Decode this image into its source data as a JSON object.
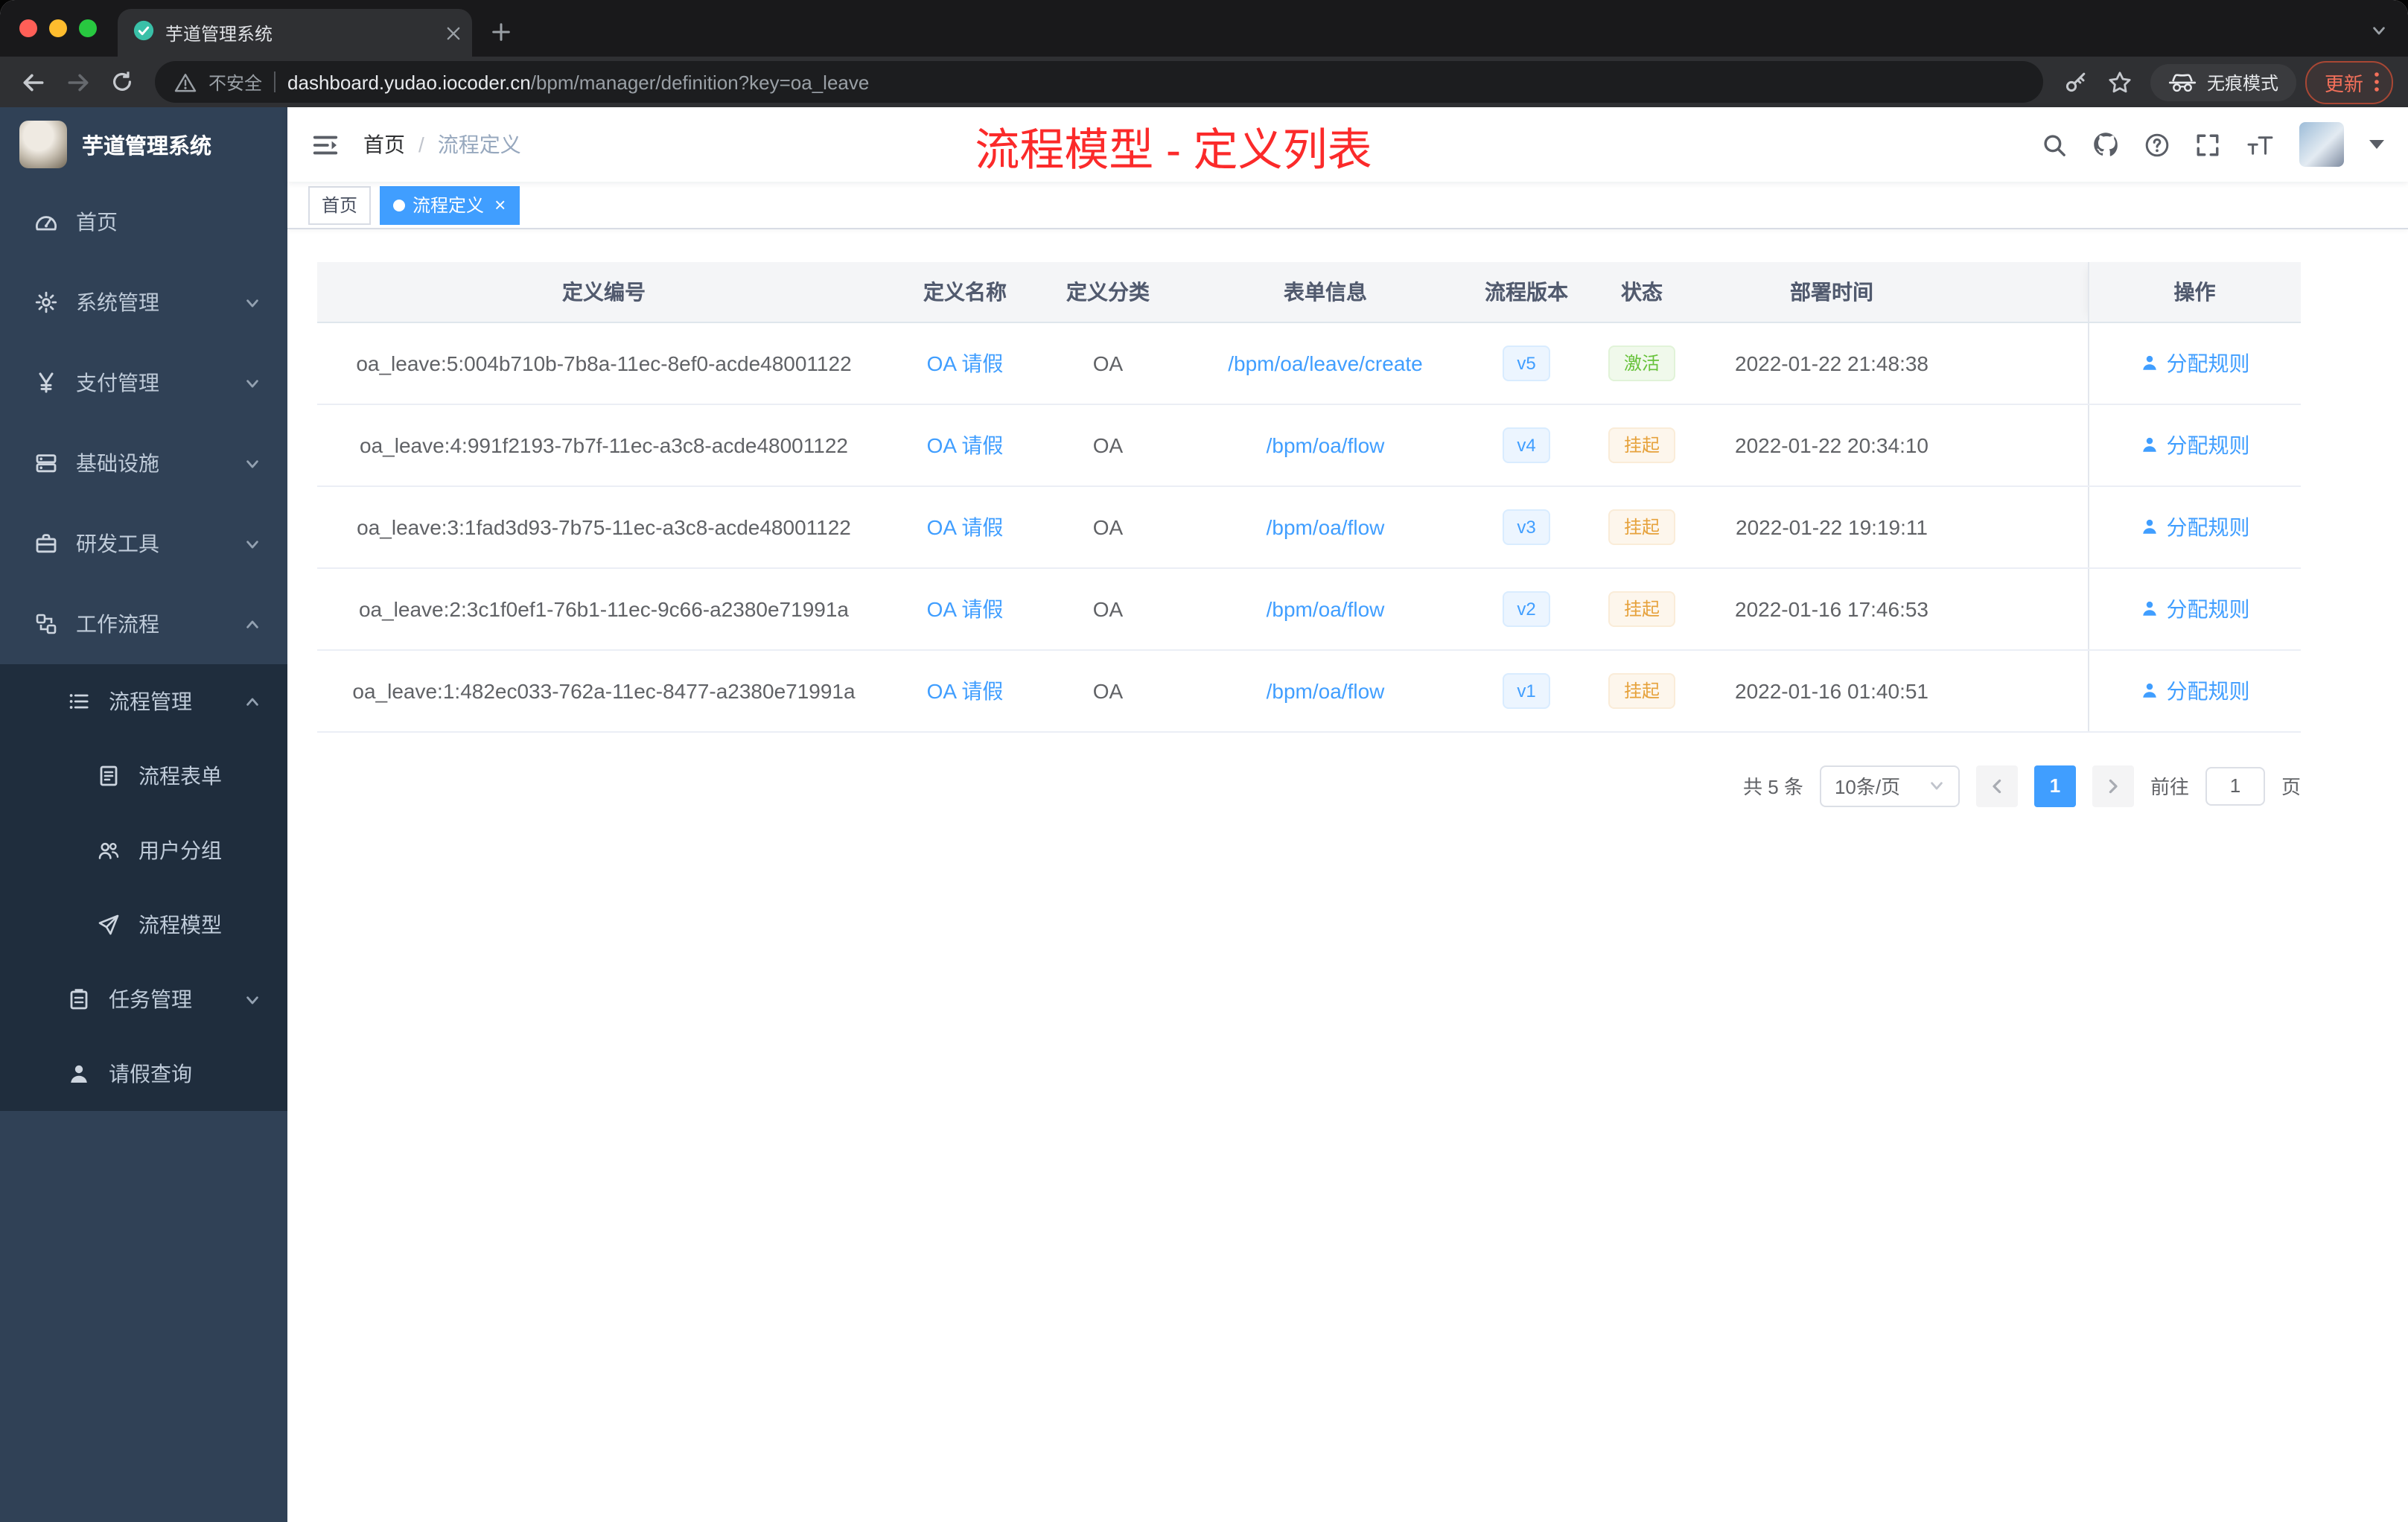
{
  "colors": {
    "accent": "#409eff",
    "annotation_red": "#fb2a2a",
    "status_active_green": "#67c23a",
    "status_suspended_orange": "#e6a23c",
    "sidebar_bg": "#304156",
    "sidebar_submenu_bg": "#1f2d3d"
  },
  "browser": {
    "tab": {
      "title": "芋道管理系统"
    },
    "address": {
      "security_label": "不安全",
      "host": "dashboard.yudao.iocoder.cn",
      "path": "/bpm/manager/definition?key=oa_leave",
      "incognito_label": "无痕模式",
      "update_label": "更新"
    }
  },
  "sidebar": {
    "logo_title": "芋道管理系统",
    "items": [
      {
        "key": "home",
        "label": "首页",
        "icon": "dashboard-icon",
        "level": 1,
        "arrow": null,
        "sub": false
      },
      {
        "key": "system-management",
        "label": "系统管理",
        "icon": "gear-icon",
        "level": 1,
        "arrow": "down",
        "sub": false
      },
      {
        "key": "payment-management",
        "label": "支付管理",
        "icon": "yen-icon",
        "level": 1,
        "arrow": "down",
        "sub": false
      },
      {
        "key": "infrastructure",
        "label": "基础设施",
        "icon": "server-icon",
        "level": 1,
        "arrow": "down",
        "sub": false
      },
      {
        "key": "dev-tools",
        "label": "研发工具",
        "icon": "toolbox-icon",
        "level": 1,
        "arrow": "down",
        "sub": false
      },
      {
        "key": "workflow",
        "label": "工作流程",
        "icon": "flow-icon",
        "level": 1,
        "arrow": "up",
        "sub": false
      },
      {
        "key": "process-management",
        "label": "流程管理",
        "icon": "list-icon",
        "level": 2,
        "arrow": "up",
        "sub": true
      },
      {
        "key": "process-form",
        "label": "流程表单",
        "icon": "form-icon",
        "level": 3,
        "arrow": null,
        "sub": true
      },
      {
        "key": "user-group",
        "label": "用户分组",
        "icon": "user-group-icon",
        "level": 3,
        "arrow": null,
        "sub": true
      },
      {
        "key": "process-model",
        "label": "流程模型",
        "icon": "paper-plane-icon",
        "level": 3,
        "arrow": null,
        "sub": true
      },
      {
        "key": "task-management",
        "label": "任务管理",
        "icon": "task-icon",
        "level": 2,
        "arrow": "down",
        "sub": true
      },
      {
        "key": "leave-query",
        "label": "请假查询",
        "icon": "person-icon",
        "level": 2,
        "arrow": null,
        "sub": true
      }
    ]
  },
  "navbar": {
    "breadcrumb": [
      {
        "label": "首页"
      },
      {
        "label": "流程定义"
      }
    ],
    "annotation": "流程模型 - 定义列表"
  },
  "tags_view": [
    {
      "key": "home",
      "label": "首页",
      "active": false,
      "closable": false
    },
    {
      "key": "process-definition",
      "label": "流程定义",
      "active": true,
      "closable": true
    }
  ],
  "table": {
    "columns": [
      "定义编号",
      "定义名称",
      "定义分类",
      "表单信息",
      "流程版本",
      "状态",
      "部署时间",
      "操作"
    ],
    "rows": [
      {
        "id": "oa_leave:5:004b710b-7b8a-11ec-8ef0-acde48001122",
        "name": "OA 请假",
        "category": "OA",
        "form": "/bpm/oa/leave/create",
        "version": "v5",
        "status": "激活",
        "status_type": "success",
        "deploy_time": "2022-01-22 21:48:38",
        "action": "分配规则"
      },
      {
        "id": "oa_leave:4:991f2193-7b7f-11ec-a3c8-acde48001122",
        "name": "OA 请假",
        "category": "OA",
        "form": "/bpm/oa/flow",
        "version": "v4",
        "status": "挂起",
        "status_type": "warning",
        "deploy_time": "2022-01-22 20:34:10",
        "action": "分配规则"
      },
      {
        "id": "oa_leave:3:1fad3d93-7b75-11ec-a3c8-acde48001122",
        "name": "OA 请假",
        "category": "OA",
        "form": "/bpm/oa/flow",
        "version": "v3",
        "status": "挂起",
        "status_type": "warning",
        "deploy_time": "2022-01-22 19:19:11",
        "action": "分配规则"
      },
      {
        "id": "oa_leave:2:3c1f0ef1-76b1-11ec-9c66-a2380e71991a",
        "name": "OA 请假",
        "category": "OA",
        "form": "/bpm/oa/flow",
        "version": "v2",
        "status": "挂起",
        "status_type": "warning",
        "deploy_time": "2022-01-16 17:46:53",
        "action": "分配规则"
      },
      {
        "id": "oa_leave:1:482ec033-762a-11ec-8477-a2380e71991a",
        "name": "OA 请假",
        "category": "OA",
        "form": "/bpm/oa/flow",
        "version": "v1",
        "status": "挂起",
        "status_type": "warning",
        "deploy_time": "2022-01-16 01:40:51",
        "action": "分配规则"
      }
    ]
  },
  "pagination": {
    "total": "共 5 条",
    "page_size": "10条/页",
    "current": "1",
    "goto_prefix": "前往",
    "goto_value": "1",
    "goto_suffix": "页"
  }
}
